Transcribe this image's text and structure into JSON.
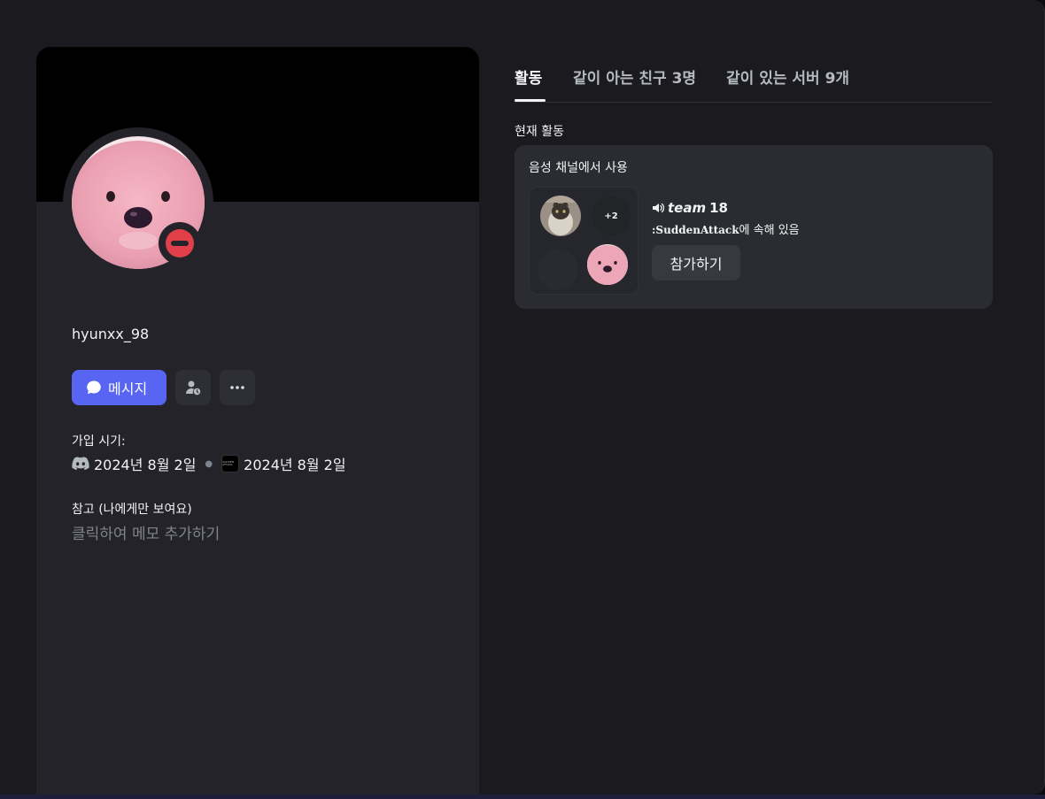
{
  "profile": {
    "username": "hyunxx_98",
    "avatar_icon": "pink-seal-avatar",
    "status": "do-not-disturb",
    "status_color": "#e1404b",
    "banner_color": "#000000"
  },
  "actions": {
    "message_label": "메시지",
    "message_icon": "chat-bubble-icon",
    "friend_icon": "pending-friend-icon",
    "more_icon": "more-dots-icon",
    "accent_color": "#5865f2"
  },
  "joined": {
    "label": "가입 시기:",
    "discord_date": "2024년 8월 2일",
    "server_date": "2024년 8월 2일",
    "server_logo_text": "SUDDEN ATTACK"
  },
  "note": {
    "label": "참고 (나에게만 보여요)",
    "placeholder": "클릭하여 메모 추가하기"
  },
  "tabs": [
    {
      "label": "활동",
      "active": true
    },
    {
      "label": "같이 아는 친구 3명",
      "active": false
    },
    {
      "label": "같이 있는 서버 9개",
      "active": false
    }
  ],
  "activity": {
    "section_label": "현재 활동",
    "title": "음성 채널에서 사용",
    "extra_count": "+2",
    "channel_name": "team",
    "channel_number": "18",
    "server_name": ":SuddenAttack",
    "server_suffix": "에 속해 있음",
    "join_label": "참가하기"
  }
}
